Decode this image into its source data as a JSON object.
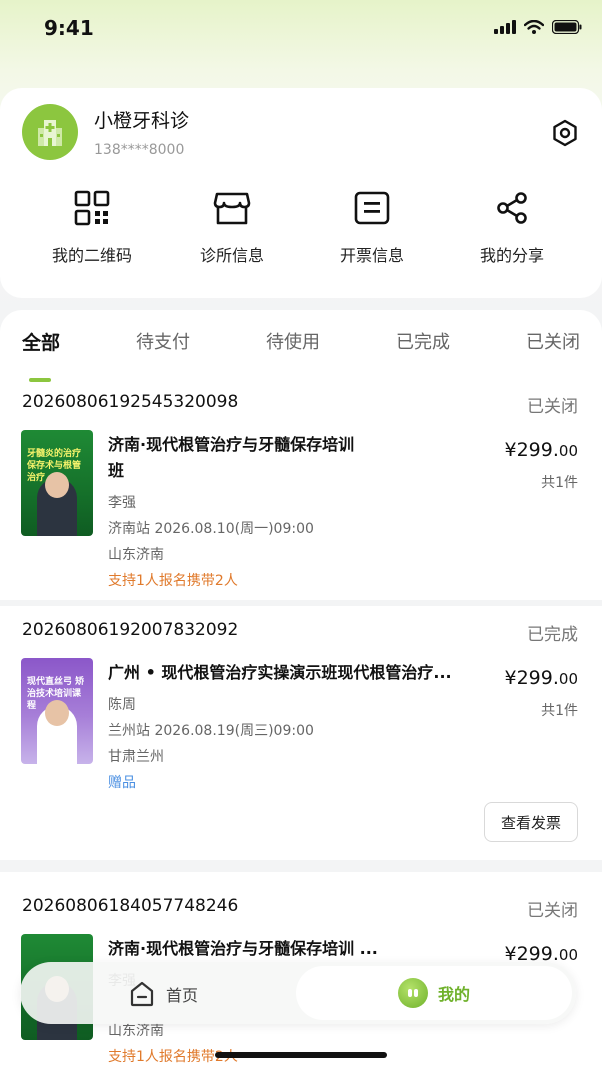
{
  "status_bar": {
    "time": "9:41"
  },
  "profile": {
    "name": "小橙牙科诊",
    "phone": "138****8000",
    "avatar_icon": "hospital-icon",
    "settings_icon": "settings-hexagon-icon"
  },
  "shortcuts": [
    {
      "label": "我的二维码",
      "icon": "qrcode-icon"
    },
    {
      "label": "诊所信息",
      "icon": "store-icon"
    },
    {
      "label": "开票信息",
      "icon": "invoice-icon"
    },
    {
      "label": "我的分享",
      "icon": "share-icon"
    }
  ],
  "tabs": [
    {
      "label": "全部",
      "active": true
    },
    {
      "label": "待支付"
    },
    {
      "label": "待使用"
    },
    {
      "label": "已完成"
    },
    {
      "label": "已关闭"
    }
  ],
  "orders": [
    {
      "order_no": "20260806192545320098",
      "status": "已关闭",
      "title": "济南·现代根管治疗与牙髓保存培训班",
      "title_line1": "济南·现代根管治疗与牙髓保存培训",
      "title_line2": "班",
      "thumb_text": "牙髓炎的治疗 保存术与根管治疗",
      "teacher": "李强",
      "session": "济南站 2026.08.10(周一)09:00",
      "location": "山东济南",
      "note": "支持1人报名携带2人",
      "price_main": "¥299.",
      "price_cents": "00",
      "qty": "共1件"
    },
    {
      "order_no": "20260806192007832092",
      "status": "已完成",
      "title": "广州 • 现代根管治疗实操演示班现代根管治疗...",
      "thumb_text": "现代直丝弓 矫治技术培训课程",
      "teacher": "陈周",
      "session": "兰州站 2026.08.19(周三)09:00",
      "location": "甘肃兰州",
      "note": "赠品",
      "price_main": "¥299.",
      "price_cents": "00",
      "qty": "共1件",
      "action": "查看发票"
    },
    {
      "order_no": "20260806184057748246",
      "status": "已关闭",
      "title": "济南·现代根管治疗与牙髓保存培训 ...",
      "teacher": "李强",
      "location": "山东济南",
      "note": "支持1人报名携带2人",
      "price_main": "¥299.",
      "price_cents": "00"
    }
  ],
  "bottom_nav": {
    "home_label": "首页",
    "home_icon": "home-icon",
    "mine_label": "我的",
    "mine_icon": "mine-face-icon"
  },
  "colors": {
    "accent": "#8cc63f",
    "mine_green": "#6fb12b",
    "note_orange": "#e07a2c",
    "note_blue": "#4a8fe2"
  }
}
